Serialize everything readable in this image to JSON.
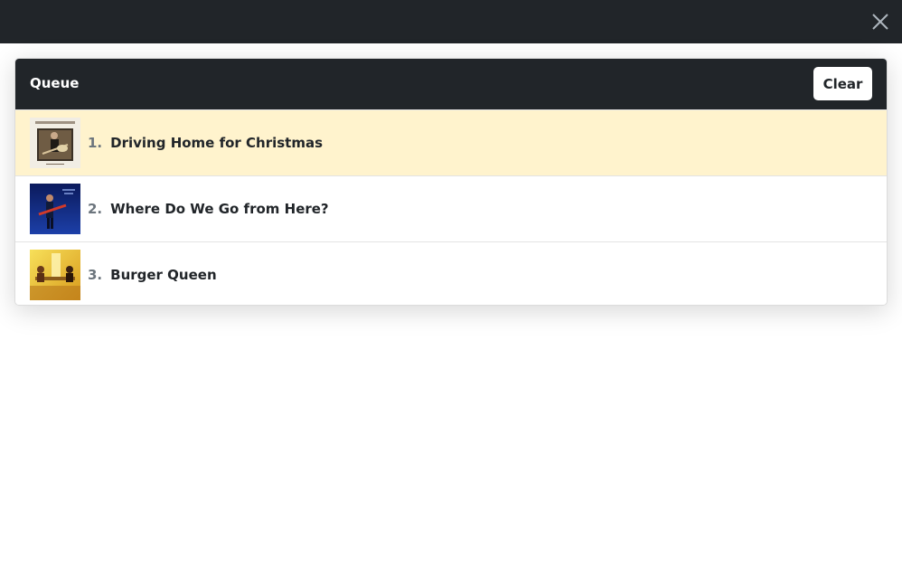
{
  "window": {
    "close_icon": "close-icon"
  },
  "queue": {
    "title": "Queue",
    "clear_label": "Clear",
    "active_color": "#fff3cd",
    "header_color": "#212529",
    "items": [
      {
        "number": "1.",
        "title": "Driving Home for Christmas",
        "active": true,
        "cover_icon": "album-cover-chris-rea"
      },
      {
        "number": "2.",
        "title": "Where Do We Go from Here?",
        "active": false,
        "cover_icon": "album-cover-blue-guitar"
      },
      {
        "number": "3.",
        "title": "Burger Queen",
        "active": false,
        "cover_icon": "album-cover-yellow-room"
      }
    ]
  }
}
